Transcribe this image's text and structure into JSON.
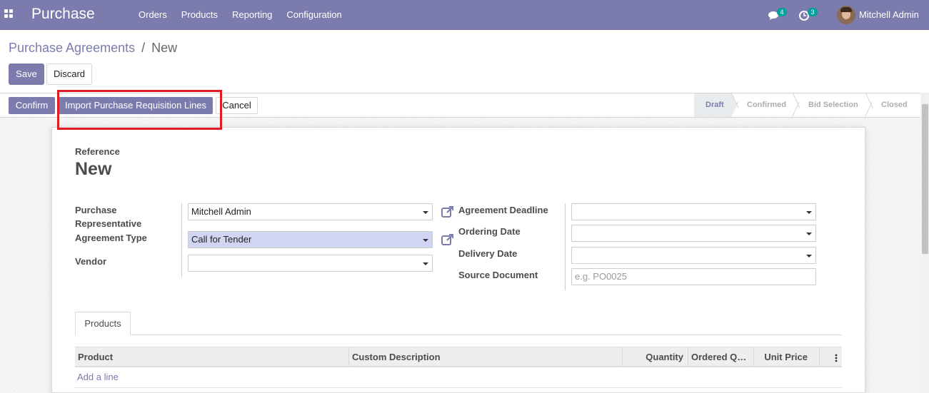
{
  "navbar": {
    "brand": "Purchase",
    "menu": [
      "Orders",
      "Products",
      "Reporting",
      "Configuration"
    ],
    "chat_count": "4",
    "activity_count": "3",
    "user_name": "Mitchell Admin"
  },
  "breadcrumb": {
    "parent": "Purchase Agreements",
    "separator": "/",
    "current": "New"
  },
  "buttons": {
    "save": "Save",
    "discard": "Discard",
    "confirm": "Confirm",
    "import": "Import Purchase Requisition Lines",
    "cancel": "Cancel"
  },
  "stages": [
    "Draft",
    "Confirmed",
    "Bid Selection",
    "Closed"
  ],
  "form": {
    "reference_label": "Reference",
    "reference_value": "New",
    "left": {
      "rep_label_1": "Purchase",
      "rep_label_2": "Representative",
      "rep_value": "Mitchell Admin",
      "type_label": "Agreement Type",
      "type_value": "Call for Tender",
      "vendor_label": "Vendor",
      "vendor_value": ""
    },
    "right": {
      "deadline_label": "Agreement Deadline",
      "ordering_label": "Ordering Date",
      "delivery_label": "Delivery Date",
      "source_label": "Source Document",
      "source_placeholder": "e.g. PO0025"
    }
  },
  "notebook": {
    "tab": "Products",
    "columns": [
      "Product",
      "Custom Description",
      "Quantity",
      "Ordered Q…",
      "Unit Price"
    ],
    "add_line": "Add a line"
  }
}
